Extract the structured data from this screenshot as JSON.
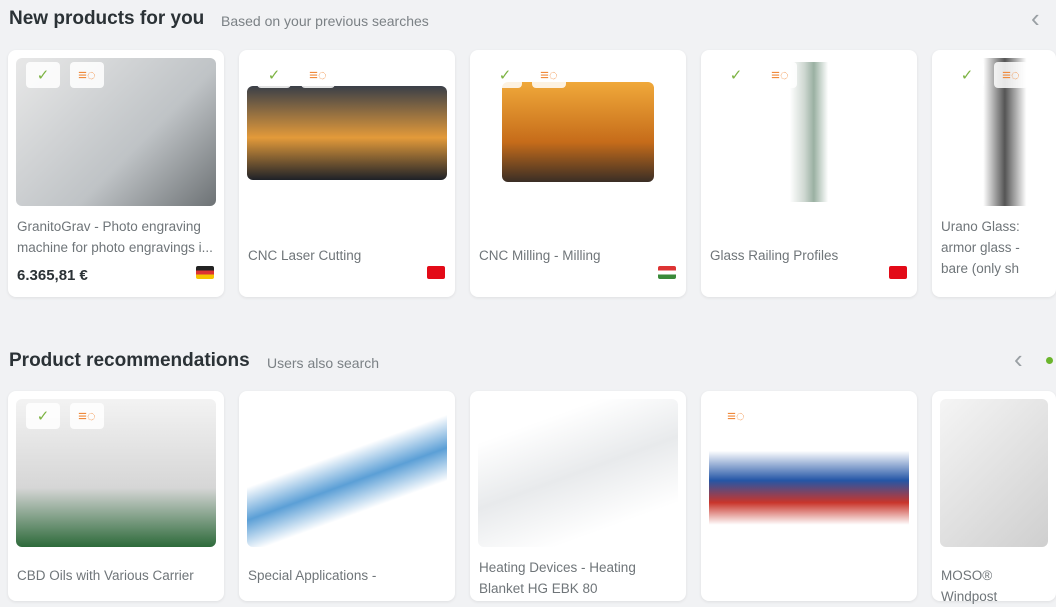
{
  "section1": {
    "title": "New products for you",
    "subtitle": "Based on previous searches",
    "products": [
      {
        "name": "GranitoGrav - Photo engraving machine for photo engravings i...",
        "price": "6.365,81 €",
        "flag": "DE"
      },
      {
        "name": "CNC Laser Cutting",
        "flag": "TR"
      },
      {
        "name": "CNC Milling - Milling",
        "flag": "HU"
      },
      {
        "name": "Glass Railing Profiles",
        "flag": "TR"
      },
      {
        "name": "Urano Glass: armor glass - bare (only sh"
      }
    ]
  },
  "section2": {
    "title": "Product recommendations",
    "subtitle": "Users also search",
    "products": [
      {
        "name": "CBD Oils with Various Carrier"
      },
      {
        "name": "Special Applications -"
      },
      {
        "name": "Heating Devices - Heating Blanket HG EBK 80"
      },
      {
        "name": ""
      },
      {
        "name": "MOSO® Windpost"
      }
    ]
  },
  "icons": {
    "verified": "verified-badge-icon",
    "chat": "chat-icon",
    "prev": "chevron-left-icon"
  },
  "colors": {
    "accent": "#6bb52c",
    "chat": "#f08a3c"
  }
}
